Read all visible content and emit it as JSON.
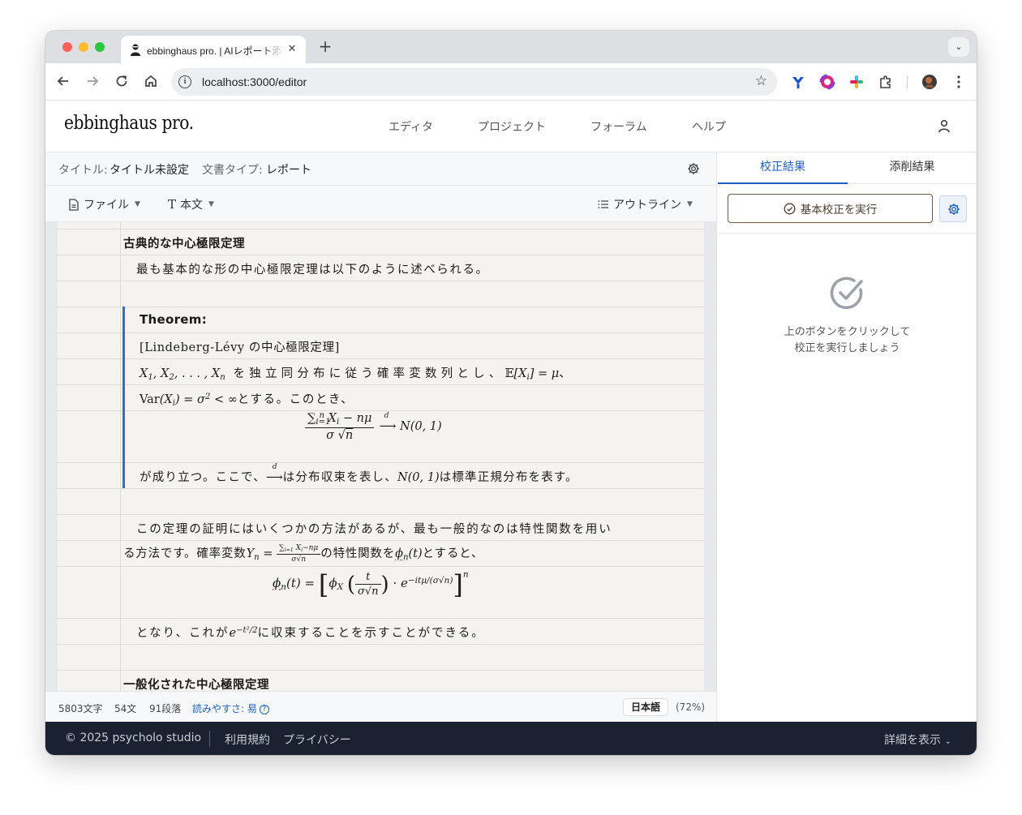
{
  "browser": {
    "tab_title": "ebbinghaus pro. | AIレポート添",
    "url": "localhost:3000/editor"
  },
  "app": {
    "logo": "ebbinghaus pro.",
    "nav": [
      "エディタ",
      "プロジェクト",
      "フォーラム",
      "ヘルプ"
    ]
  },
  "doc_meta": {
    "title_label": "タイトル:",
    "title_value": "タイトル未設定",
    "type_label": "文書タイプ:",
    "type_value": "レポート"
  },
  "format_bar": {
    "file": "ファイル",
    "style": "本文",
    "outline": "アウトライン"
  },
  "document": {
    "h1": "古典的な中心極限定理",
    "p1": "最も基本的な形の中心極限定理は以下のように述べられる。",
    "theorem_title": "Theorem:",
    "theorem_name": "[Lindeberg-Lévy の中心極限定理]",
    "t_line1_text1": "を独立同分布に従う確率変数列とし、",
    "t_line1_text2": "、",
    "t_line2_text": "とする。このとき、",
    "t_after_1": "が成り立つ。ここで、",
    "t_after_2": "は分布収束を表し、",
    "t_after_3": "は標準正規分布を表す。",
    "p2_line1": "この定理の証明にはいくつかの方法があるが、最も一般的なのは特性関数を用い",
    "p2_line2_a": "る方法です。確率変数",
    "p2_line2_b": "の特性関数を",
    "p2_line2_c": "とすると、",
    "p3_a": "となり、これが",
    "p3_b": "に収束することを示すことができる。",
    "h2": "一般化された中心極限定理"
  },
  "status": {
    "chars": "5803文字",
    "sentences": "54文",
    "paragraphs": "91段落",
    "readability": "読みやすさ: 易",
    "language": "日本語",
    "zoom": "(72%)"
  },
  "side_panel": {
    "tab_active": "校正結果",
    "tab_inactive": "添削結果",
    "run_button": "基本校正を実行",
    "empty_line1": "上のボタンをクリックして",
    "empty_line2": "校正を実行しましょう"
  },
  "footer": {
    "copyright": "© 2025 psycholo studio",
    "terms": "利用規約",
    "privacy": "プライバシー",
    "details": "詳細を表示"
  },
  "colors": {
    "accent": "#1f5fc4",
    "theorem_bar": "#2b6fd6",
    "footer_bg": "#1a2130",
    "paper_bg": "#f5f3ef"
  }
}
